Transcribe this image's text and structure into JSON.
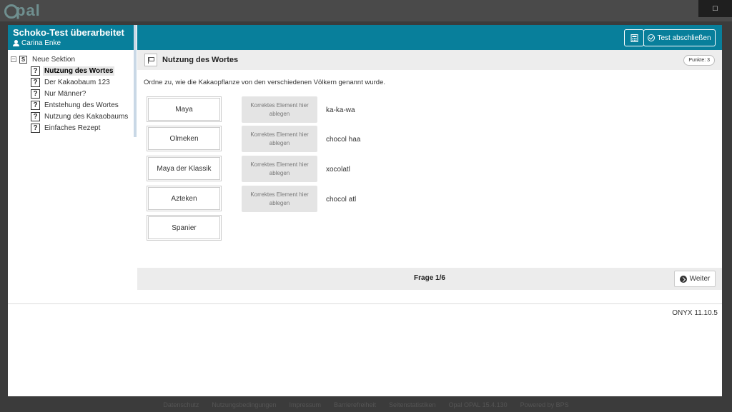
{
  "app": {
    "logo_text": "pal",
    "close_symbol": "□"
  },
  "sidebar": {
    "test_title": "Schoko-Test überarbeitet",
    "user_name": "Carina Enke",
    "section_label": "Neue Sektion",
    "section_icon": "S",
    "items": [
      {
        "label": "Nutzung des Wortes",
        "active": true
      },
      {
        "label": "Der Kakaobaum 123",
        "active": false
      },
      {
        "label": "Nur Männer?",
        "active": false
      },
      {
        "label": "Entstehung des Wortes",
        "active": false
      },
      {
        "label": "Nutzung des Kakaobaums",
        "active": false
      },
      {
        "label": "Einfaches Rezept",
        "active": false
      }
    ]
  },
  "toolbar": {
    "end_test_label": "Test abschließen",
    "calculator_icon": "calculator-icon"
  },
  "question": {
    "title": "Nutzung des Wortes",
    "points": "Punkte: 3",
    "instruction": "Ordne zu, wie die Kakaopflanze von den verschiedenen Völkern genannt wurde.",
    "sources": [
      "Maya",
      "Olmeken",
      "Maya der Klassik",
      "Azteken",
      "Spanier"
    ],
    "target_placeholder": "Korrektes Element hier ablegen",
    "targets": [
      "ka-ka-wa",
      "chocol haa",
      "xocolatl",
      "chocol atl"
    ]
  },
  "navigation": {
    "progress": "Frage 1/6",
    "next_label": "Weiter"
  },
  "footer": {
    "version": "ONYX 11.10.5",
    "links": [
      "Datenschutz",
      "Nutzungsbedingungen",
      "Impressum",
      "Barrierefreiheit",
      "Seitenstatistiken",
      "Opal OPAL 15.4.130",
      "Powered by BPS"
    ]
  },
  "colors": {
    "accent": "#087f9b",
    "target_bg": "#e4e4e4"
  }
}
